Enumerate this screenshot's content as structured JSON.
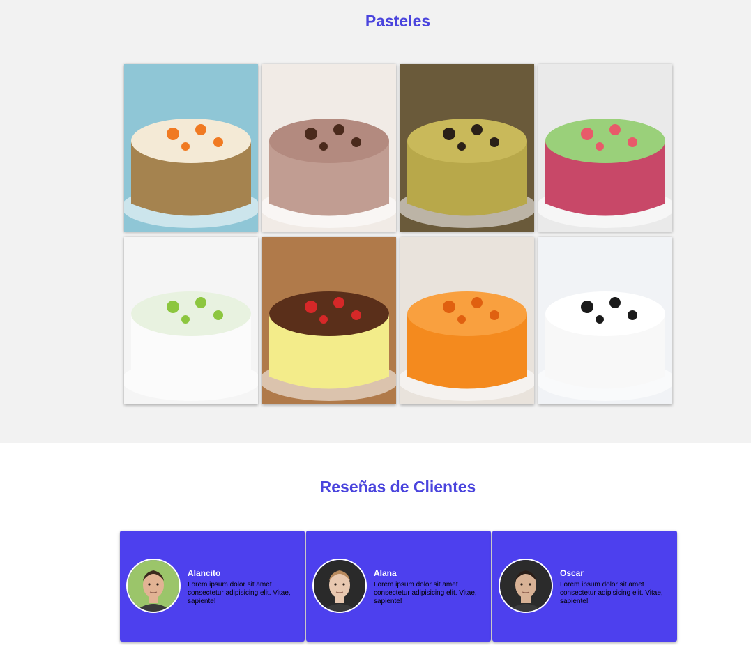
{
  "cakes": {
    "title": "Pasteles",
    "items": [
      {
        "image": "carrot-cake-image",
        "colors": {
          "bg": "#8fc6d6",
          "body": "#a5834f",
          "top": "#f4ead6",
          "accent": "#f07a22"
        }
      },
      {
        "image": "chocolate-mousse-cake-image",
        "colors": {
          "bg": "#f1ebe6",
          "body": "#c19d92",
          "top": "#b38a7f",
          "accent": "#4a2a1c"
        }
      },
      {
        "image": "sponge-cake-image",
        "colors": {
          "bg": "#6a5a3a",
          "body": "#b8a84a",
          "top": "#c9b95a",
          "accent": "#2a2018"
        }
      },
      {
        "image": "jelly-mosaic-cake-image",
        "colors": {
          "bg": "#eaeaea",
          "body": "#c84868",
          "top": "#9ad07a",
          "accent": "#e85a6a"
        }
      },
      {
        "image": "lime-cake-image",
        "colors": {
          "bg": "#f5f5f5",
          "body": "#fbfbfb",
          "top": "#e8f2e0",
          "accent": "#8cc63f"
        }
      },
      {
        "image": "strawberry-chocolate-cake-image",
        "colors": {
          "bg": "#b07a4a",
          "body": "#f3ec8a",
          "top": "#5a2f1a",
          "accent": "#d62828"
        }
      },
      {
        "image": "orange-petal-cake-image",
        "colors": {
          "bg": "#e9e3dc",
          "body": "#f48a1e",
          "top": "#f9a03f",
          "accent": "#e06010"
        }
      },
      {
        "image": "oreo-cheesecake-image",
        "colors": {
          "bg": "#f1f3f6",
          "body": "#f8f8f8",
          "top": "#ffffff",
          "accent": "#1a1a1a"
        }
      }
    ]
  },
  "reviews": {
    "title": "Reseñas de Clientes",
    "items": [
      {
        "name": "Alancito",
        "text": "Lorem ipsum dolor sit amet consectetur adipisicing elit. Vitae, sapiente!",
        "avatar": "man-avatar",
        "avatar_bg": "#9bc56a",
        "skin": "#e2b394",
        "hair": "#3a2a1e"
      },
      {
        "name": "Alana",
        "text": "Lorem ipsum dolor sit amet consectetur adipisicing elit. Vitae, sapiente!",
        "avatar": "woman-avatar",
        "avatar_bg": "#2a2a2a",
        "skin": "#e8c8b0",
        "hair": "#b88a5e"
      },
      {
        "name": "Oscar",
        "text": "Lorem ipsum dolor sit amet consectetur adipisicing elit. Vitae, sapiente!",
        "avatar": "man-avatar",
        "avatar_bg": "#2b2b2b",
        "skin": "#d8b296",
        "hair": "#2a1e18"
      }
    ]
  }
}
